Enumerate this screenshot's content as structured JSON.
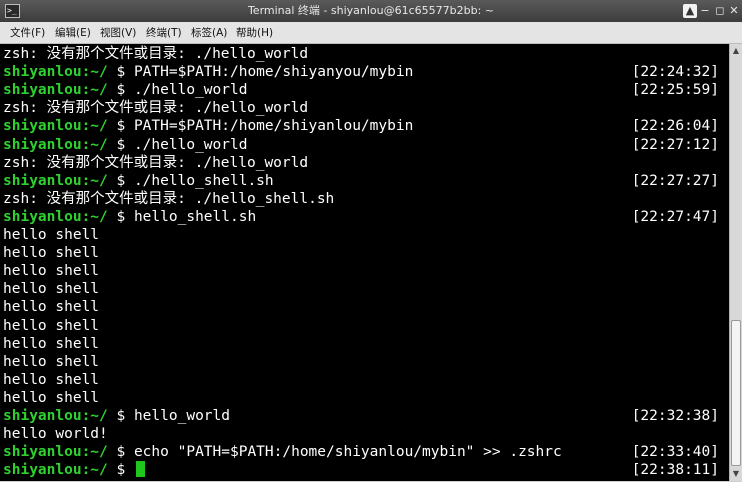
{
  "window": {
    "title": "Terminal 终端 - shiyanlou@61c65577b2bb: ~",
    "buttons": [
      "▲",
      "−",
      "◻",
      "✕"
    ]
  },
  "menu": [
    "文件(F)",
    "编辑(E)",
    "视图(V)",
    "终端(T)",
    "标签(A)",
    "帮助(H)"
  ],
  "terminal": {
    "lines": [
      {
        "prompt": "",
        "text": "zsh: 没有那个文件或目录: ./hello_world",
        "time": ""
      },
      {
        "prompt": "shiyanlou:~/",
        "text": " $ PATH=$PATH:/home/shiyanyou/mybin",
        "time": "[22:24:32]"
      },
      {
        "prompt": "shiyanlou:~/",
        "text": " $ ./hello_world",
        "time": "[22:25:59]"
      },
      {
        "prompt": "",
        "text": "zsh: 没有那个文件或目录: ./hello_world",
        "time": ""
      },
      {
        "prompt": "shiyanlou:~/",
        "text": " $ PATH=$PATH:/home/shiyanlou/mybin",
        "time": "[22:26:04]"
      },
      {
        "prompt": "shiyanlou:~/",
        "text": " $ ./hello_world",
        "time": "[22:27:12]"
      },
      {
        "prompt": "",
        "text": "zsh: 没有那个文件或目录: ./hello_world",
        "time": ""
      },
      {
        "prompt": "shiyanlou:~/",
        "text": " $ ./hello_shell.sh",
        "time": "[22:27:27]"
      },
      {
        "prompt": "",
        "text": "zsh: 没有那个文件或目录: ./hello_shell.sh",
        "time": ""
      },
      {
        "prompt": "shiyanlou:~/",
        "text": " $ hello_shell.sh",
        "time": "[22:27:47]"
      },
      {
        "prompt": "",
        "text": "hello shell",
        "time": ""
      },
      {
        "prompt": "",
        "text": "hello shell",
        "time": ""
      },
      {
        "prompt": "",
        "text": "hello shell",
        "time": ""
      },
      {
        "prompt": "",
        "text": "hello shell",
        "time": ""
      },
      {
        "prompt": "",
        "text": "hello shell",
        "time": ""
      },
      {
        "prompt": "",
        "text": "hello shell",
        "time": ""
      },
      {
        "prompt": "",
        "text": "hello shell",
        "time": ""
      },
      {
        "prompt": "",
        "text": "hello shell",
        "time": ""
      },
      {
        "prompt": "",
        "text": "hello shell",
        "time": ""
      },
      {
        "prompt": "",
        "text": "hello shell",
        "time": ""
      },
      {
        "prompt": "shiyanlou:~/",
        "text": " $ hello_world",
        "time": "[22:32:38]"
      },
      {
        "prompt": "",
        "text": "hello world!",
        "time": ""
      },
      {
        "prompt": "shiyanlou:~/",
        "text": " $ echo \"PATH=$PATH:/home/shiyanlou/mybin\" >> .zshrc",
        "time": "[22:33:40]"
      },
      {
        "prompt": "shiyanlou:~/",
        "text": " $ ",
        "time": "[22:38:11]",
        "cursor": true
      }
    ]
  },
  "colors": {
    "background": "#000000",
    "foreground": "#ffffff",
    "prompt": "#2fd12f",
    "cursor": "#1ec61e"
  },
  "icons": {
    "app": "terminal-icon",
    "scroll_up": "chevron-up-icon",
    "scroll_down": "chevron-down-icon"
  }
}
